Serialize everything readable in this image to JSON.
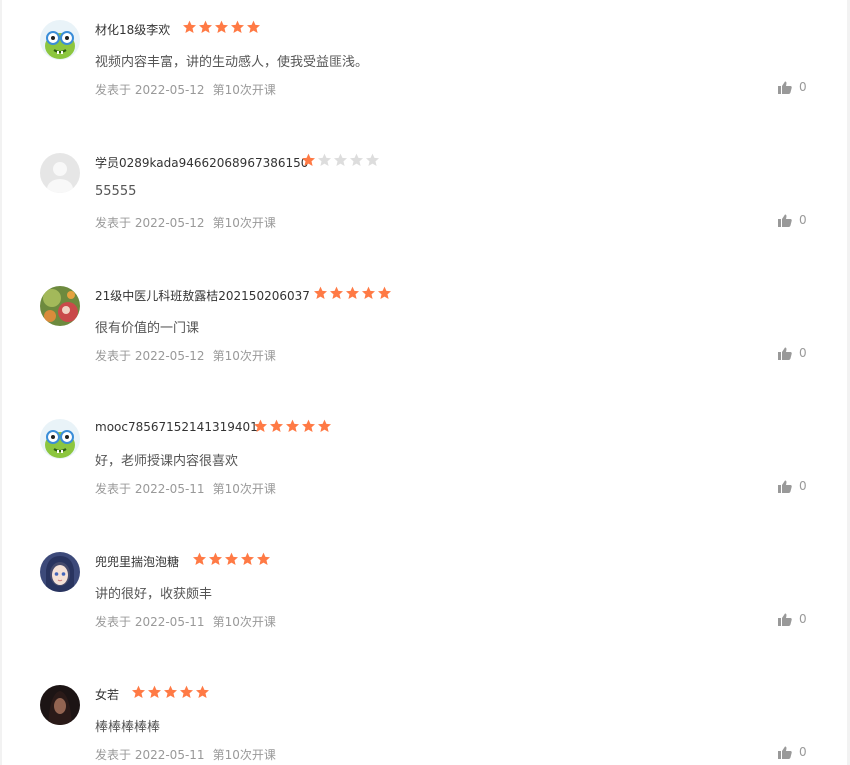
{
  "colors": {
    "star_on": "#ff7a45",
    "star_off": "#dddddd",
    "text_meta": "#999999"
  },
  "reviews": [
    {
      "user": "材化18级李欢",
      "rating": 5,
      "content": "视频内容丰富，讲的生动感人，使我受益匪浅。",
      "date": "发表于 2022-05-12",
      "term": "第10次开课",
      "likes": "0",
      "avatar": "green-monster-avatar"
    },
    {
      "user": "学员0289kada94662068967386150",
      "rating": 1,
      "content": "55555",
      "date": "发表于 2022-05-12",
      "term": "第10次开课",
      "likes": "0",
      "avatar": "default-person-avatar"
    },
    {
      "user": "21级中医儿科班敖露桔202150206037",
      "rating": 5,
      "content": "很有价值的一门课",
      "date": "发表于 2022-05-12",
      "term": "第10次开课",
      "likes": "0",
      "avatar": "photo-avatar-flower"
    },
    {
      "user": "mooc78567152141319401",
      "rating": 5,
      "content": "好，老师授课内容很喜欢",
      "date": "发表于 2022-05-11",
      "term": "第10次开课",
      "likes": "0",
      "avatar": "green-monster-avatar"
    },
    {
      "user": "兜兜里揣泡泡糖",
      "rating": 5,
      "content": "讲的很好，收获颇丰",
      "date": "发表于 2022-05-11",
      "term": "第10次开课",
      "likes": "0",
      "avatar": "anime-girl-avatar"
    },
    {
      "user": "女若",
      "rating": 5,
      "content": "棒棒棒棒棒",
      "date": "发表于 2022-05-11",
      "term": "第10次开课",
      "likes": "0",
      "avatar": "dark-photo-avatar"
    }
  ]
}
